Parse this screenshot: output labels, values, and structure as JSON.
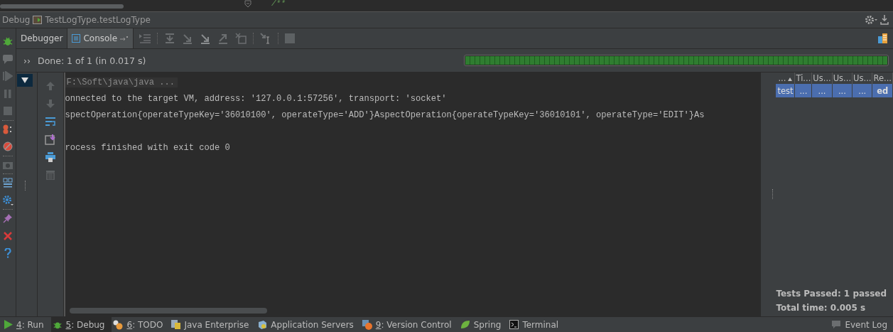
{
  "editor_fragment": {
    "comment": "/**"
  },
  "debug_header": {
    "label": "Debug",
    "config": "TestLogType.testLogType"
  },
  "tabs": [
    {
      "label": "Debugger",
      "selected": false
    },
    {
      "label": "Console",
      "selected": true
    }
  ],
  "status": {
    "toggle": "››",
    "text": "Done: 1 of 1 (in 0.017 s)",
    "level": 1.0
  },
  "tree": {
    "expanded": true
  },
  "console_lines": [
    {
      "kind": "command",
      "text": "F:\\Soft\\java\\java ..."
    },
    {
      "kind": "output",
      "text": "onnected to the target VM, address: '127.0.0.1:57256', transport: 'socket'"
    },
    {
      "kind": "output",
      "text": "spectOperation{operateTypeKey='36010100', operateType='ADD'}AspectOperation{operateTypeKey='36010101', operateType='EDIT'}As"
    },
    {
      "kind": "blank"
    },
    {
      "kind": "output",
      "text": "rocess finished with exit code 0"
    }
  ],
  "results_table": {
    "columns": [
      {
        "label": "...",
        "sorted": true
      },
      {
        "label": "Ti...",
        "sorted": false
      },
      {
        "label": "Us...",
        "sorted": false
      },
      {
        "label": "Us...",
        "sorted": false
      },
      {
        "label": "Us...",
        "sorted": false
      },
      {
        "label": "Re...",
        "sorted": false
      }
    ],
    "rows": [
      {
        "selected": true,
        "cells": [
          "test",
          "...",
          "...",
          "...",
          "...",
          "ed"
        ]
      }
    ]
  },
  "summary": [
    "Tests Passed: 1 passed",
    "Total time: 0.005 s"
  ],
  "tool_windows": [
    {
      "number": "4",
      "label": ": Run",
      "selected": false
    },
    {
      "number": "5",
      "label": ": Debug",
      "selected": true
    },
    {
      "number": "6",
      "label": ": TODO",
      "selected": false
    },
    {
      "label": "Java Enterprise",
      "selected": false
    },
    {
      "label": "Application Servers",
      "selected": false
    },
    {
      "number": "9",
      "label": ": Version Control",
      "selected": false
    },
    {
      "label": "Spring",
      "selected": false
    },
    {
      "label": "Terminal",
      "selected": false
    }
  ],
  "event_log": "Event Log"
}
